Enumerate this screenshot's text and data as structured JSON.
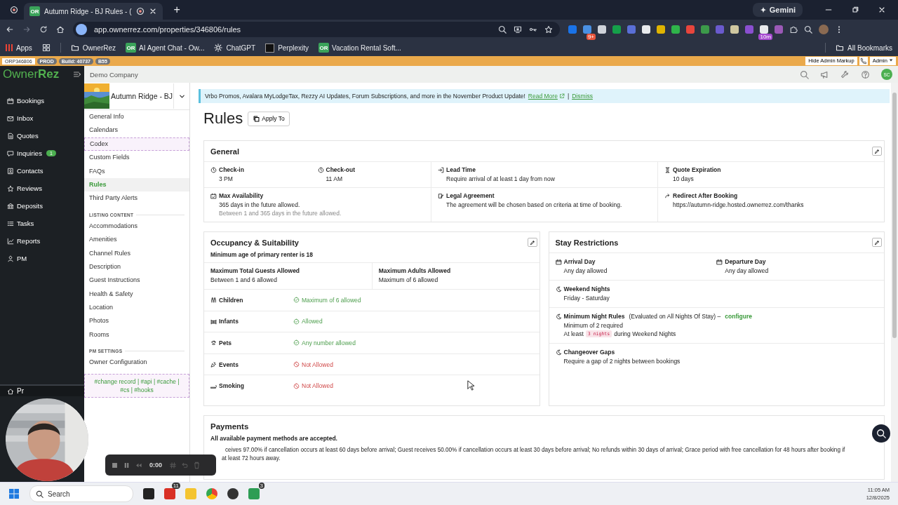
{
  "browser": {
    "tab_favicon": "OR",
    "tab_title": "Autumn Ridge - BJ Rules - (",
    "new_tab": "+",
    "gemini": "Gemini",
    "forward_disabled": true,
    "url": "app.ownerrez.com/properties/346806/rules",
    "extension_badges": [
      "9+",
      "10m"
    ],
    "bookmarks": [
      {
        "label": "Apps",
        "kind": "apps"
      },
      {
        "label": "OwnerRez",
        "kind": "folder"
      },
      {
        "label": "AI Agent Chat - Ow...",
        "kind": "site",
        "favicon": "OR"
      },
      {
        "label": "ChatGPT",
        "kind": "chatgpt"
      },
      {
        "label": "Perplexity",
        "kind": "perplexity"
      },
      {
        "label": "Vacation Rental Soft...",
        "kind": "site",
        "favicon": "OR"
      }
    ],
    "all_bookmarks": "All Bookmarks"
  },
  "admin_bar": {
    "badges": [
      "ORP346806",
      "PROD",
      "Build: 40737",
      "B55"
    ],
    "hide_markup": "Hide Admin Markup",
    "admin_menu": "Admin"
  },
  "app": {
    "logo_light": "Owner",
    "logo_bold": "Rez",
    "company": "Demo Company",
    "user_initials": "SC",
    "nav": [
      {
        "label": "Bookings"
      },
      {
        "label": "Inbox"
      },
      {
        "label": "Quotes"
      },
      {
        "label": "Inquiries",
        "badge": "1"
      },
      {
        "label": "Contacts"
      },
      {
        "label": "Reviews"
      },
      {
        "label": "Deposits"
      },
      {
        "label": "Tasks"
      },
      {
        "label": "Reports"
      },
      {
        "label": "PM"
      }
    ],
    "nav_bottom": "Pr",
    "property": "Autumn Ridge - BJ",
    "menu_groups": [
      {
        "items": [
          {
            "label": "General Info",
            "selected": false,
            "admin": false
          },
          {
            "label": "Calendars",
            "selected": false,
            "admin": false
          },
          {
            "label": "Codex",
            "selected": false,
            "admin": true
          },
          {
            "label": "Custom Fields",
            "selected": false,
            "admin": false
          },
          {
            "label": "FAQs",
            "selected": false,
            "admin": false
          },
          {
            "label": "Rules",
            "selected": true,
            "admin": false
          },
          {
            "label": "Third Party Alerts",
            "selected": false,
            "admin": false
          }
        ]
      },
      {
        "heading": "LISTING CONTENT",
        "items": [
          {
            "label": "Accommodations",
            "selected": false,
            "admin": false
          },
          {
            "label": "Amenities",
            "selected": false,
            "admin": false
          },
          {
            "label": "Channel Rules",
            "selected": false,
            "admin": false
          },
          {
            "label": "Description",
            "selected": false,
            "admin": false
          },
          {
            "label": "Guest Instructions",
            "selected": false,
            "admin": false
          },
          {
            "label": "Health & Safety",
            "selected": false,
            "admin": false
          },
          {
            "label": "Location",
            "selected": false,
            "admin": false
          },
          {
            "label": "Photos",
            "selected": false,
            "admin": false
          },
          {
            "label": "Rooms",
            "selected": false,
            "admin": false
          }
        ]
      },
      {
        "heading": "PM SETTINGS",
        "items": [
          {
            "label": "Owner Configuration",
            "selected": false,
            "admin": false
          }
        ]
      }
    ],
    "admin_tags": "#change record | #api | #cache | #cs | #hooks"
  },
  "banner": {
    "text": "Vrbo Promos, Avalara MyLodgeTax, Rezzy AI Updates, Forum Subscriptions, and more in the November Product Update!",
    "read_more": "Read More",
    "separator": "|",
    "dismiss": "Dismiss"
  },
  "page": {
    "title": "Rules",
    "apply_to": "Apply To",
    "general": {
      "title": "General",
      "rows": [
        [
          {
            "entries": [
              {
                "label": "Check-in",
                "value": "3 PM"
              },
              {
                "label": "Check-out",
                "value": "11 AM"
              }
            ]
          },
          {
            "entries": [
              {
                "label": "Lead Time",
                "value": "Require arrival of at least 1 day from now"
              }
            ]
          },
          {
            "entries": [
              {
                "label": "Quote Expiration",
                "value": "10 days"
              }
            ]
          }
        ],
        [
          {
            "entries": [
              {
                "label": "Max Availability",
                "value": "365 days in the future allowed.",
                "note": "Between 1 and 365 days in the future allowed."
              }
            ]
          },
          {
            "entries": [
              {
                "label": "Legal Agreement",
                "value": "The agreement will be chosen based on criteria at time of booking."
              }
            ]
          },
          {
            "entries": [
              {
                "label": "Redirect After Booking",
                "value": "https://autumn-ridge.hosted.ownerrez.com/thanks"
              }
            ]
          }
        ]
      ]
    },
    "occupancy": {
      "title": "Occupancy & Suitability",
      "subtitle": "Minimum age of primary renter is 18",
      "limits": [
        {
          "label": "Maximum Total Guests Allowed",
          "value": "Between 1 and 6 allowed"
        },
        {
          "label": "Maximum Adults Allowed",
          "value": "Maximum of 6 allowed"
        }
      ],
      "rows": [
        {
          "label": "Children",
          "status": "Maximum of 6 allowed",
          "allowed": true
        },
        {
          "label": "Infants",
          "status": "Allowed",
          "allowed": true
        },
        {
          "label": "Pets",
          "status": "Any number allowed",
          "allowed": true
        },
        {
          "label": "Events",
          "status": "Not Allowed",
          "allowed": false
        },
        {
          "label": "Smoking",
          "status": "Not Allowed",
          "allowed": false
        }
      ]
    },
    "stay": {
      "title": "Stay Restrictions",
      "sections": [
        {
          "kind": "pair",
          "entries": [
            {
              "label": "Arrival Day",
              "value": "Any day allowed"
            },
            {
              "label": "Departure Day",
              "value": "Any day allowed"
            }
          ]
        },
        {
          "kind": "simple",
          "label": "Weekend Nights",
          "value": "Friday - Saturday"
        },
        {
          "kind": "min_nights",
          "label": "Minimum Night Rules",
          "note": "(Evaluated on All Nights Of Stay) –",
          "link": "configure",
          "value": "Minimum of 2 required",
          "at_least": "At least",
          "code": "3 nights",
          "after": "during Weekend Nights"
        },
        {
          "kind": "simple",
          "label": "Changeover Gaps",
          "value": "Require a gap of 2 nights between bookings"
        }
      ]
    },
    "payments": {
      "title": "Payments",
      "subtitle": "All available payment methods are accepted.",
      "lines": [
        "ceives 97.00% if cancellation occurs at least 60 days before arrival; Guest receives 50.00% if cancellation occurs at least 30 days before arrival; No refunds within 30 days of arrival; Grace period with free cancellation for 48 hours after booking if",
        "at least 72 hours away."
      ]
    }
  },
  "recorder": {
    "time": "0:00"
  },
  "taskbar": {
    "search": "Search",
    "badges": [
      "11",
      "3"
    ],
    "time": "11:05 AM",
    "date": "12/8/2025"
  }
}
